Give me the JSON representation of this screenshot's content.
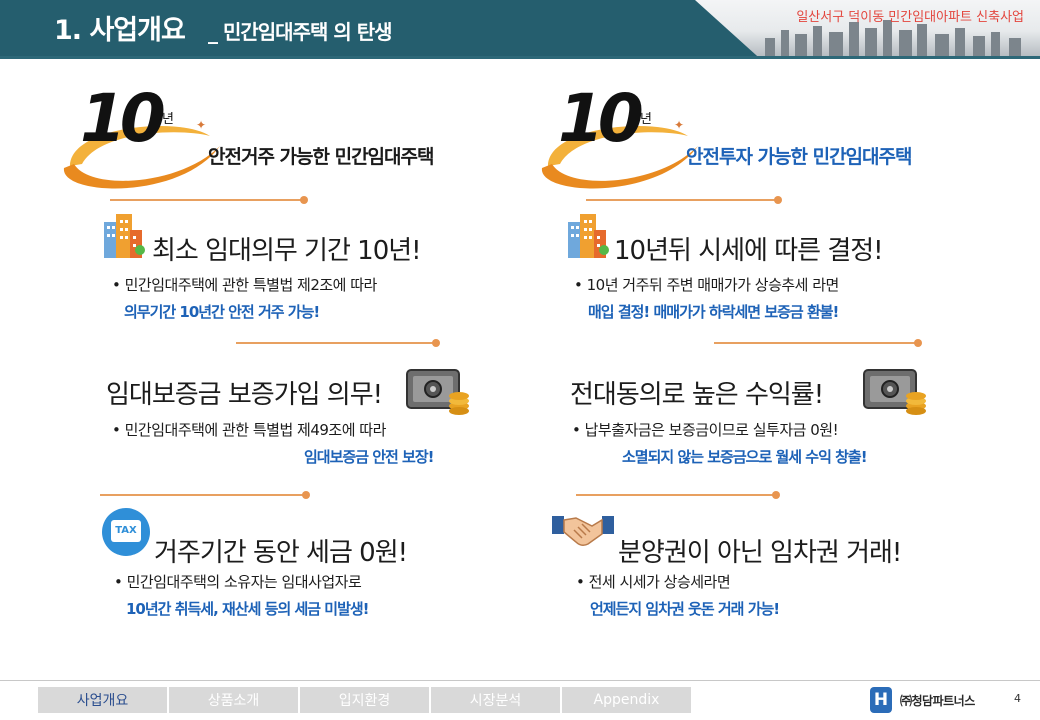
{
  "header": {
    "title": "1. 사업개요",
    "subtitle": "_ 민간임대주택 의 탄생",
    "project": "일산서구 덕이동 민간임대아파트 신축사업"
  },
  "left_logo": {
    "number": "10",
    "unit": "년",
    "caption": "안전거주 가능한 민간임대주택"
  },
  "right_logo": {
    "number": "10",
    "unit": "년",
    "caption": "안전투자 가능한 민간임대주택"
  },
  "left_sections": [
    {
      "title": "최소 임대의무 기간 10년!",
      "bullet": "• 민간임대주택에 관한 특별법 제2조에 따라",
      "highlight": "의무기간 10년간 안전 거주 가능!"
    },
    {
      "title": "임대보증금 보증가입 의무!",
      "bullet": "• 민간임대주택에 관한 특별법 제49조에 따라",
      "highlight": "임대보증금 안전 보장!"
    },
    {
      "title": "거주기간 동안 세금 0원!",
      "bullet": "• 민간임대주택의 소유자는 임대사업자로",
      "highlight": "10년간 취득세, 재산세 등의 세금 미발생!"
    }
  ],
  "right_sections": [
    {
      "title": "10년뒤 시세에 따른 결정!",
      "bullet": "• 10년 거주뒤 주변 매매가가 상승추세 라면",
      "highlight": "매입 결정! 매매가가 하락세면 보증금 환불!"
    },
    {
      "title": "전대동의로 높은 수익률!",
      "bullet": "• 납부출자금은 보증금이므로 실투자금 0원!",
      "highlight": "소멸되지 않는 보증금으로 월세 수익 창출!"
    },
    {
      "title": "분양권이 아닌 임차권 거래!",
      "bullet": "• 전세 시세가 상승세라면",
      "highlight": "언제든지 임차권 웃돈 거래 가능!"
    }
  ],
  "icons": {
    "tax_label": "TAX"
  },
  "footer": {
    "tabs": [
      {
        "label": "사업개요",
        "active": true
      },
      {
        "label": "상품소개",
        "active": false
      },
      {
        "label": "입지환경",
        "active": false
      },
      {
        "label": "시장분석",
        "active": false
      },
      {
        "label": "Appendix",
        "active": false
      }
    ],
    "brand_mark": "H",
    "brand_name": "㈜청담파트너스",
    "page_number": "4"
  },
  "colors": {
    "header_bg": "#255e6e",
    "accent_orange": "#e8954f",
    "highlight_blue": "#1d62b7",
    "caption_blue": "#1d62b7",
    "project_red": "#e3463e"
  }
}
